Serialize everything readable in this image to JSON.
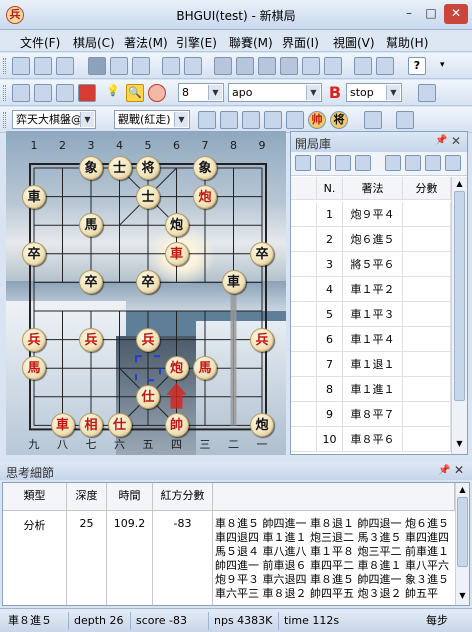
{
  "window": {
    "title": "BHGUI(test) - 新棋局",
    "app_icon_glyph": "兵",
    "min": "–",
    "max": "□",
    "close": "✕"
  },
  "menu": [
    "文件(F)",
    "棋局(C)",
    "著法(M)",
    "引擎(E)",
    "聯賽(M)",
    "界面(I)",
    "視圖(V)",
    "幫助(H)"
  ],
  "toolbar2": {
    "depth_value": "8",
    "engine_value": "apo",
    "stop_value": "stop"
  },
  "toolbar3": {
    "engine_combo": "弈天大棋盤@◎",
    "mode_combo": "觀戰(紅走)",
    "red_button_glyph": "帅",
    "black_button_glyph": "将"
  },
  "board": {
    "files_top": [
      "1",
      "2",
      "3",
      "4",
      "5",
      "6",
      "7",
      "8",
      "9"
    ],
    "files_bottom": [
      "九",
      "八",
      "七",
      "六",
      "五",
      "四",
      "三",
      "二",
      "一"
    ],
    "pieces": [
      {
        "char": "象",
        "side": "black",
        "file": 2,
        "rank": 0
      },
      {
        "char": "士",
        "side": "black",
        "file": 3,
        "rank": 0
      },
      {
        "char": "将",
        "side": "black",
        "file": 4,
        "rank": 0
      },
      {
        "char": "象",
        "side": "black",
        "file": 6,
        "rank": 0
      },
      {
        "char": "車",
        "side": "black",
        "file": 0,
        "rank": 1
      },
      {
        "char": "士",
        "side": "black",
        "file": 4,
        "rank": 1
      },
      {
        "char": "炮",
        "side": "red",
        "file": 6,
        "rank": 1
      },
      {
        "char": "馬",
        "side": "black",
        "file": 2,
        "rank": 2
      },
      {
        "char": "炮",
        "side": "black",
        "file": 5,
        "rank": 2
      },
      {
        "char": "卒",
        "side": "black",
        "file": 0,
        "rank": 3
      },
      {
        "char": "車",
        "side": "red",
        "file": 5,
        "rank": 3
      },
      {
        "char": "卒",
        "side": "black",
        "file": 8,
        "rank": 3
      },
      {
        "char": "卒",
        "side": "black",
        "file": 2,
        "rank": 4
      },
      {
        "char": "卒",
        "side": "black",
        "file": 4,
        "rank": 4
      },
      {
        "char": "車",
        "side": "black",
        "file": 7,
        "rank": 4
      },
      {
        "char": "兵",
        "side": "red",
        "file": 0,
        "rank": 6
      },
      {
        "char": "兵",
        "side": "red",
        "file": 2,
        "rank": 6
      },
      {
        "char": "兵",
        "side": "red",
        "file": 4,
        "rank": 6
      },
      {
        "char": "兵",
        "side": "red",
        "file": 8,
        "rank": 6
      },
      {
        "char": "馬",
        "side": "red",
        "file": 0,
        "rank": 7
      },
      {
        "char": "炮",
        "side": "red",
        "file": 5,
        "rank": 7
      },
      {
        "char": "馬",
        "side": "red",
        "file": 6,
        "rank": 7
      },
      {
        "char": "仕",
        "side": "red",
        "file": 4,
        "rank": 8
      },
      {
        "char": "車",
        "side": "red",
        "file": 1,
        "rank": 9
      },
      {
        "char": "相",
        "side": "red",
        "file": 2,
        "rank": 9
      },
      {
        "char": "仕",
        "side": "red",
        "file": 3,
        "rank": 9
      },
      {
        "char": "帥",
        "side": "red",
        "file": 5,
        "rank": 9
      },
      {
        "char": "炮",
        "side": "black",
        "file": 8,
        "rank": 9
      }
    ],
    "selection_point": {
      "file": 4,
      "rank": 7
    },
    "arrow_colors": {
      "red_arrow": "#d8231b",
      "grey_arrow": "#9a9a9a"
    }
  },
  "library": {
    "title": "開局庫",
    "headers": [
      "N.",
      "著法",
      "分數"
    ],
    "rows": [
      {
        "n": "1",
        "move": "炮９平４",
        "score": ""
      },
      {
        "n": "2",
        "move": "炮６進５",
        "score": ""
      },
      {
        "n": "3",
        "move": "將５平６",
        "score": ""
      },
      {
        "n": "4",
        "move": "車１平２",
        "score": ""
      },
      {
        "n": "5",
        "move": "車１平３",
        "score": ""
      },
      {
        "n": "6",
        "move": "車１平４",
        "score": ""
      },
      {
        "n": "7",
        "move": "車１退１",
        "score": ""
      },
      {
        "n": "8",
        "move": "車１進１",
        "score": ""
      },
      {
        "n": "9",
        "move": "車８平７",
        "score": ""
      },
      {
        "n": "10",
        "move": "車８平６",
        "score": ""
      }
    ]
  },
  "thinking": {
    "title": "思考細節",
    "headers": [
      "類型",
      "深度",
      "時間",
      "紅方分數",
      ""
    ],
    "row": {
      "type": "分析",
      "depth": "25",
      "time": "109.2",
      "score": "-83",
      "pv": "車８進５ 帥四進一 車８退１ 帥四退一 炮６進５ 車四退四 車１進１ 炮三退二 馬３進５ 車四進四 馬５退４ 車八進八 車１平８ 炮三平二 前車進１ 帥四進一 前車退６ 車四平二 車８進１ 車八平六 炮９平３ 車六退四 車８進５ 帥四進一 象３進５ 車六平三 車８退２ 帥四平五 炮３退２ 帥五平"
    }
  },
  "status": {
    "move": "車８進５",
    "depth": "depth 26",
    "score": "score -83",
    "nps": "nps 4383K",
    "time": "time 112s",
    "mode": "每步"
  }
}
